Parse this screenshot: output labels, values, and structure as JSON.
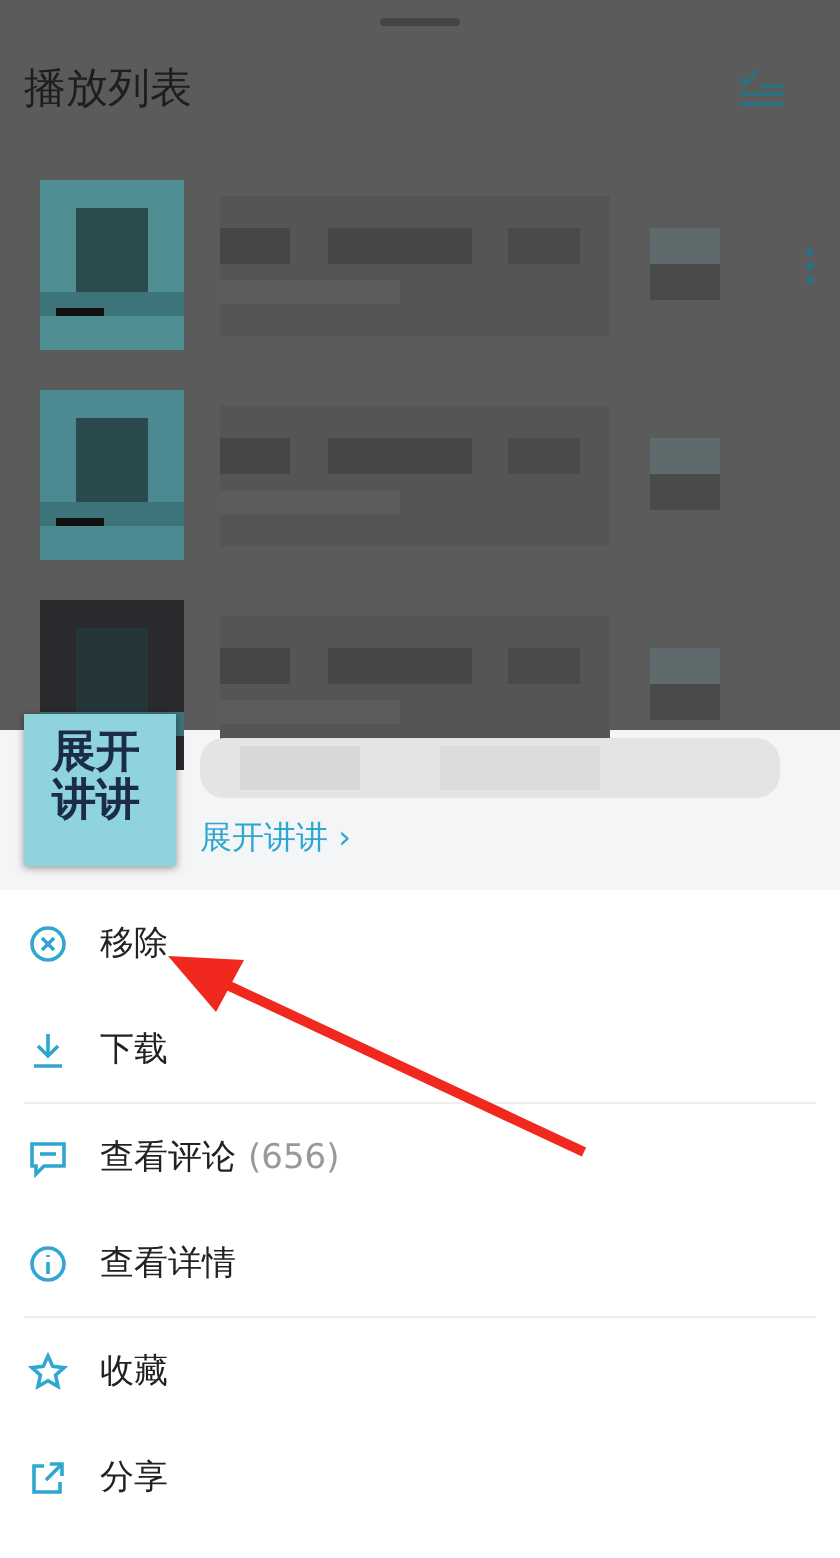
{
  "playlist": {
    "title": "播放列表"
  },
  "sheet": {
    "cover_text": "展开讲讲",
    "channel_link": "展开讲讲 ›"
  },
  "menu_groups": [
    [
      {
        "kind": "remove",
        "label": "移除"
      },
      {
        "kind": "download",
        "label": "下载"
      }
    ],
    [
      {
        "kind": "comments",
        "label": "查看评论",
        "count": "(656)"
      },
      {
        "kind": "details",
        "label": "查看详情"
      }
    ],
    [
      {
        "kind": "favorite",
        "label": "收藏"
      },
      {
        "kind": "share",
        "label": "分享"
      }
    ]
  ]
}
